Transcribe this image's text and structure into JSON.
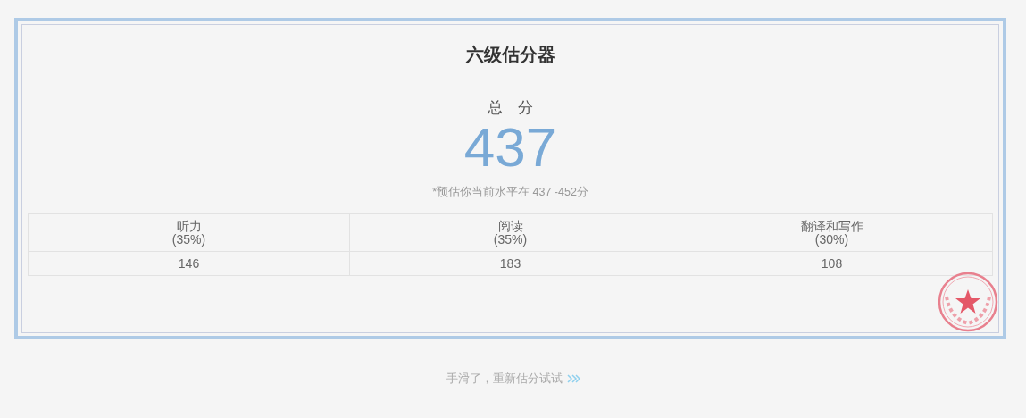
{
  "title": "六级估分器",
  "total": {
    "label": "总　分",
    "score": "437",
    "note": "*预估你当前水平在 437 -452分"
  },
  "table": {
    "columns": [
      {
        "name": "听力",
        "weight": "(35%)"
      },
      {
        "name": "阅读",
        "weight": "(35%)"
      },
      {
        "name": "翻译和写作",
        "weight": "(30%)"
      }
    ],
    "scores": [
      "146",
      "183",
      "108"
    ]
  },
  "retry_link": "手滑了，重新估分试试"
}
